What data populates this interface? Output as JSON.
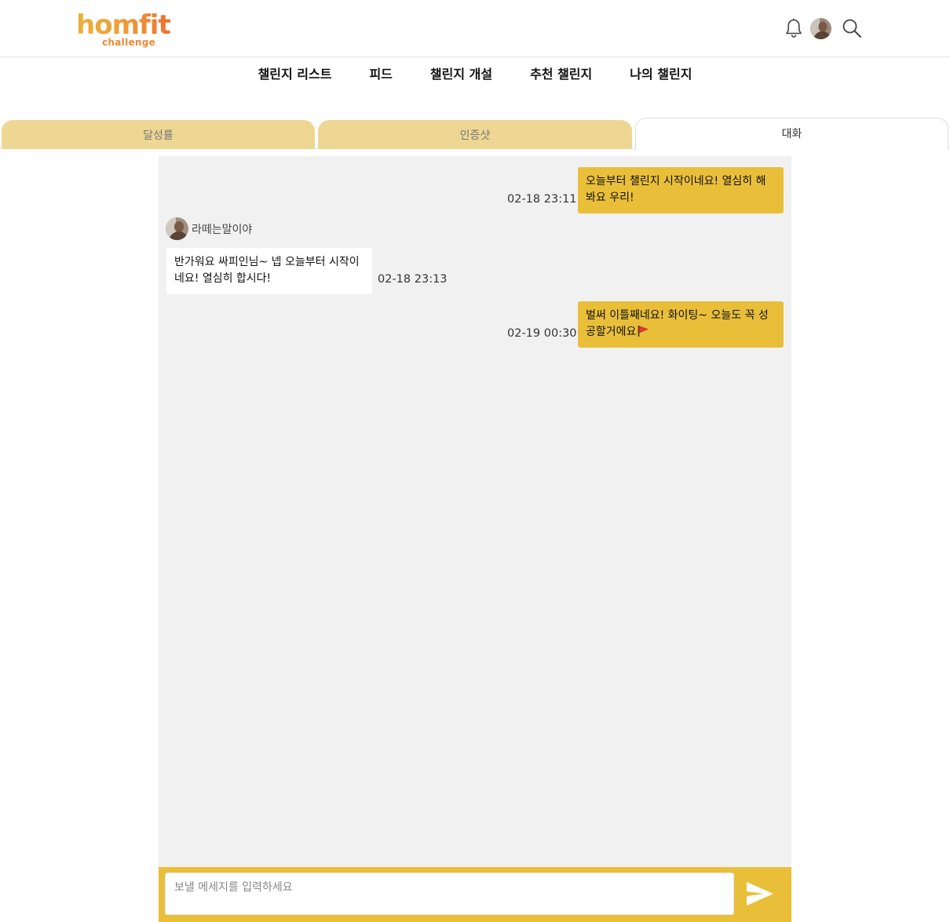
{
  "header": {
    "logo_main": "homfit",
    "logo_sub": "challenge",
    "icons": [
      "bell-icon",
      "user-avatar",
      "search-icon"
    ]
  },
  "nav": {
    "items": [
      {
        "label": "챌린지 리스트"
      },
      {
        "label": "피드"
      },
      {
        "label": "챌린지 개설"
      },
      {
        "label": "추천 챌린지"
      },
      {
        "label": "나의 챌린지"
      }
    ]
  },
  "tabs": [
    {
      "label": "달성률",
      "active": false
    },
    {
      "label": "인증샷",
      "active": false
    },
    {
      "label": "대화",
      "active": true
    }
  ],
  "chat": {
    "messages": [
      {
        "mine": true,
        "text": "오늘부터 챌린지 시작이네요! 열심히 해봐요 우리!",
        "time": "02-18 23:11"
      },
      {
        "mine": false,
        "sender": "라떼는말이야",
        "text": "반가워요 싸피인님~ 넵 오늘부터 시작이네요! 열심히 합시다!",
        "time": "02-18 23:13"
      },
      {
        "mine": true,
        "text": "벌써 이틀째네요! 화이팅~ 오늘도 꼭 성공할거에요",
        "emoji": "🚩",
        "time": "02-19 00:30"
      }
    ]
  },
  "input": {
    "placeholder": "보낼 메세지를 입력하세요",
    "value": ""
  },
  "colors": {
    "accent": "#e9bf3a",
    "tab_inactive": "#eed793",
    "chat_bg": "#f1f1f1",
    "flag": "#e8372c"
  }
}
